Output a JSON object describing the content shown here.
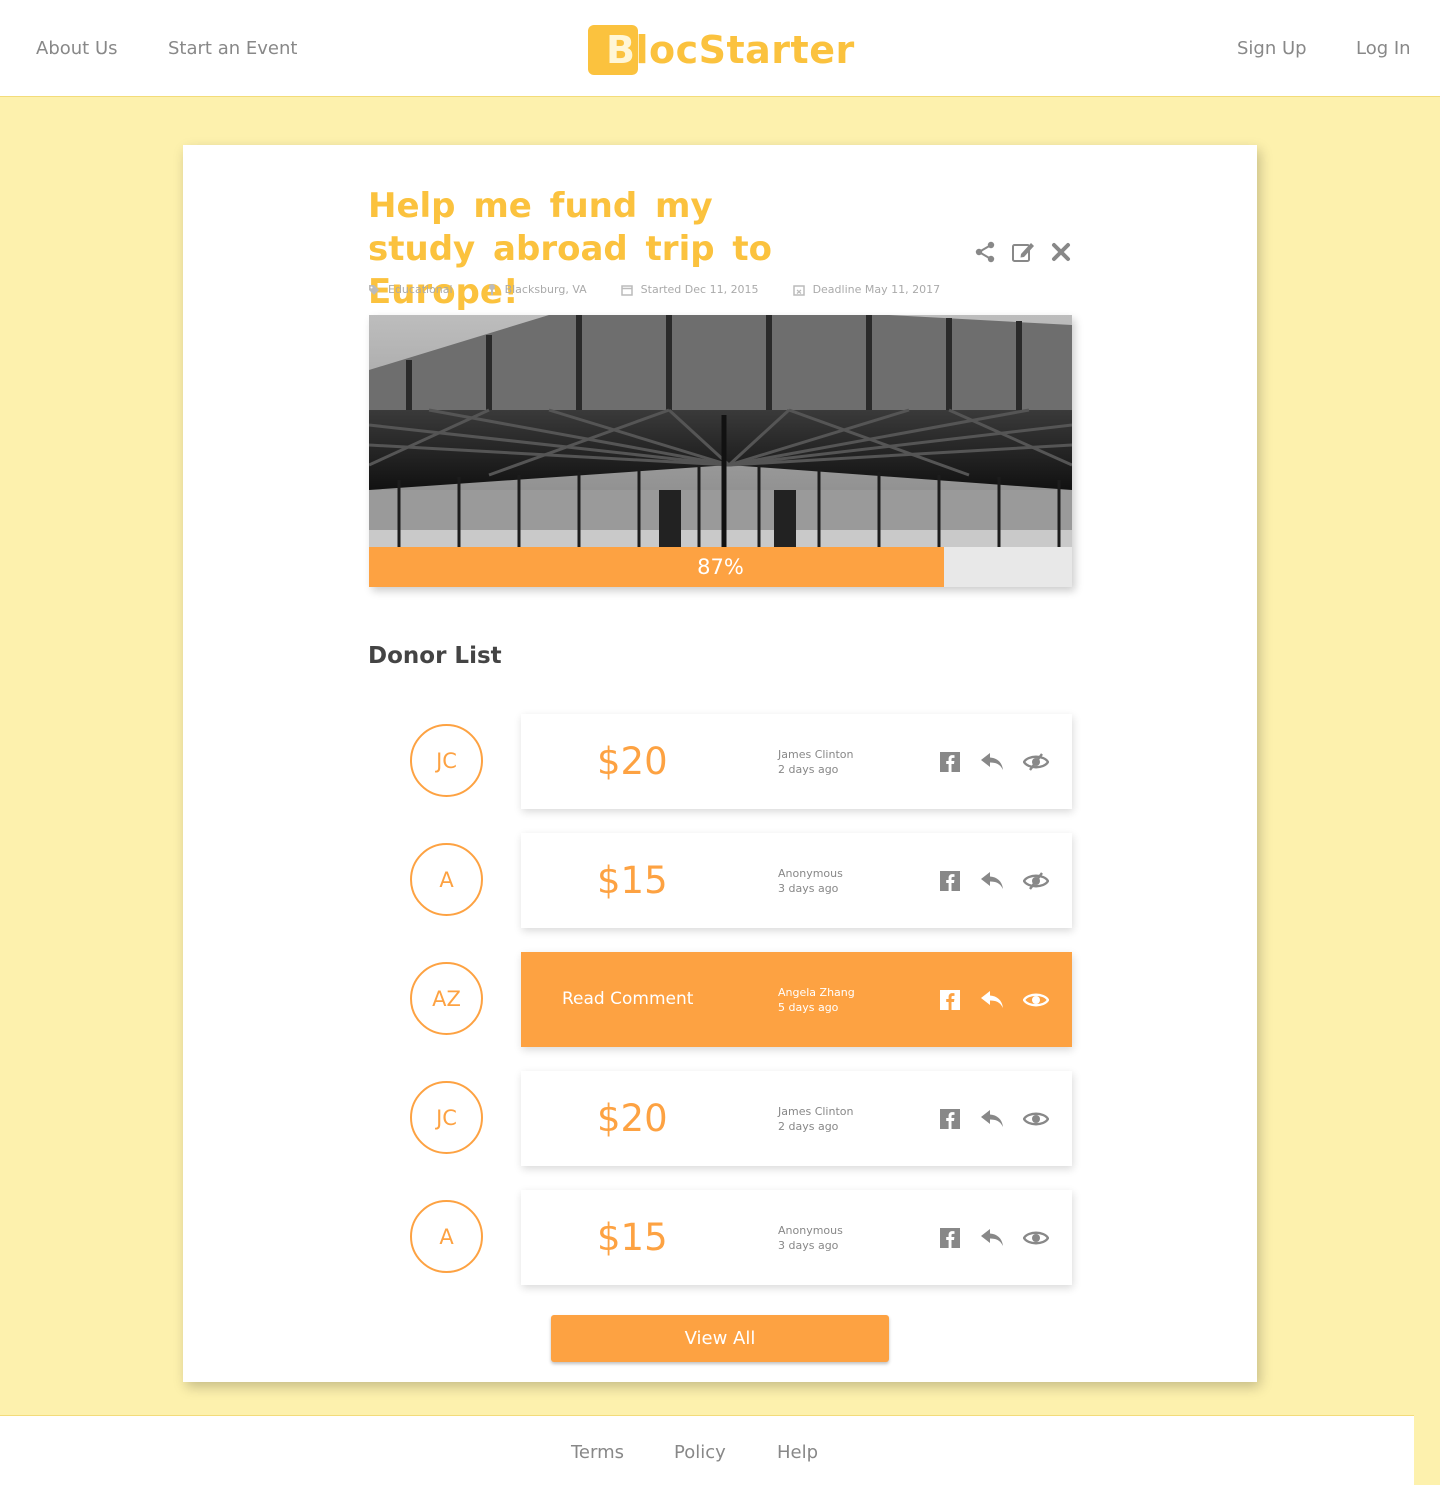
{
  "header": {
    "nav_left": [
      "About Us",
      "Start an Event"
    ],
    "logo": {
      "first_letter": "B",
      "rest": "locStarter"
    },
    "nav_right": [
      "Sign Up",
      "Log In"
    ]
  },
  "campaign": {
    "title": "Help me fund my study abroad trip to Europe!",
    "meta": {
      "category": "Educational",
      "location": "Blacksburg, VA",
      "started": "Started Dec 11, 2015",
      "deadline": "Deadline May 11, 2017"
    },
    "progress": {
      "value": 0.87,
      "label": "87%"
    }
  },
  "donor_list": {
    "heading": "Donor List",
    "donors": [
      {
        "initials": "JC",
        "amount": "$20",
        "name": "James Clinton",
        "when": "2 days ago",
        "active": false,
        "comment_visible": false
      },
      {
        "initials": "A",
        "amount": "$15",
        "name": "Anonymous",
        "when": "3 days ago",
        "active": false,
        "comment_visible": false
      },
      {
        "initials": "AZ",
        "amount": "Read Comment",
        "name": "Angela Zhang",
        "when": "5 days ago",
        "active": true,
        "comment_visible": true
      },
      {
        "initials": "JC",
        "amount": "$20",
        "name": "James Clinton",
        "when": "2 days ago",
        "active": false,
        "comment_visible": true
      },
      {
        "initials": "A",
        "amount": "$15",
        "name": "Anonymous",
        "when": "3 days ago",
        "active": false,
        "comment_visible": true
      }
    ],
    "view_all_label": "View All"
  },
  "icons": {
    "title_actions": [
      "share-icon",
      "edit-icon",
      "close-icon"
    ],
    "meta": [
      "tag-icon",
      "map-pin-icon",
      "calendar-icon",
      "calendar-deadline-icon"
    ],
    "row": [
      "facebook-icon",
      "reply-icon",
      "eye-icon"
    ]
  },
  "footer": {
    "links": [
      "Terms",
      "Policy",
      "Help"
    ]
  },
  "colors": {
    "background": "#fdf1ad",
    "brand_yellow": "#fbc23e",
    "accent_orange": "#fda242",
    "icon_gray": "#888888"
  }
}
